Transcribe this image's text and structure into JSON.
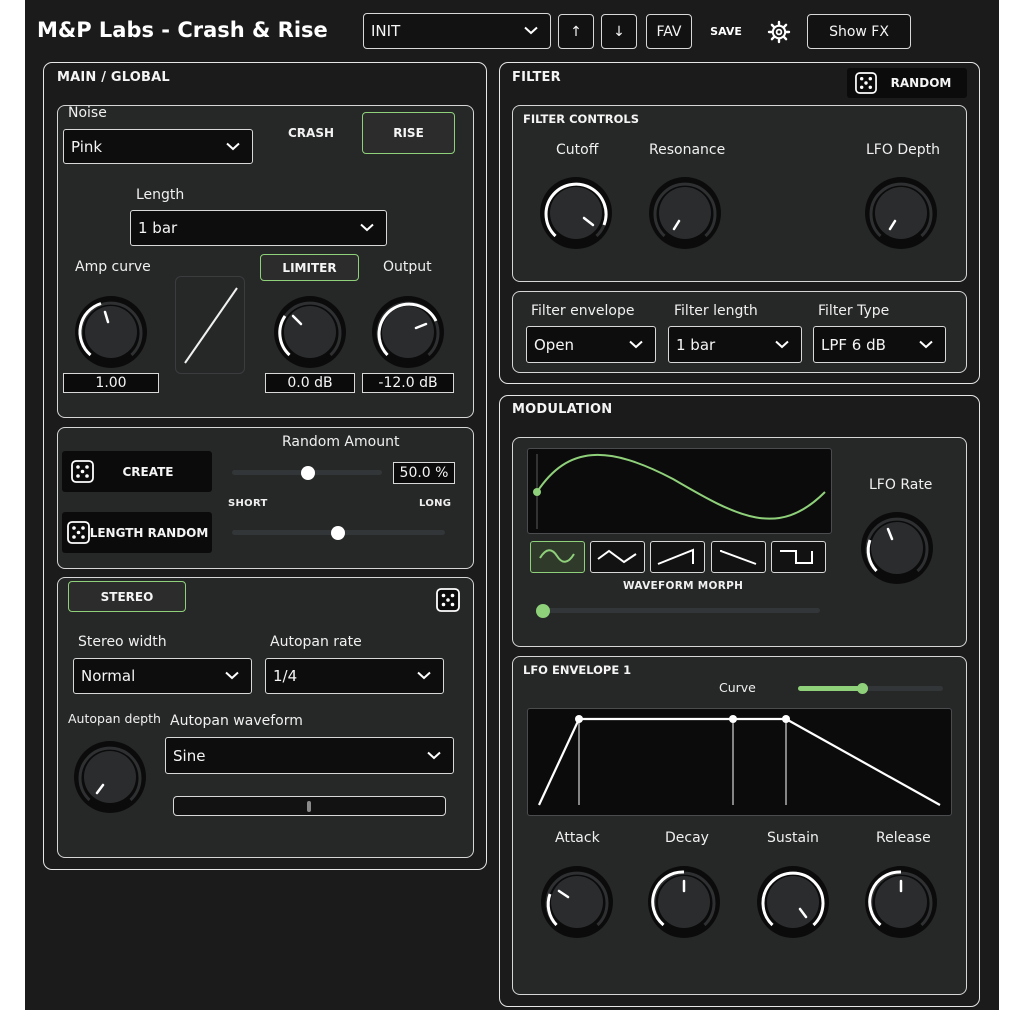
{
  "app": {
    "title": "M&P Labs - Crash & Rise"
  },
  "topbar": {
    "preset": "INIT",
    "up_label": "↑",
    "down_label": "↓",
    "fav_label": "FAV",
    "save_label": "SAVE",
    "showfx_label": "Show FX"
  },
  "main": {
    "title": "MAIN / GLOBAL",
    "noise_label": "Noise",
    "noise_value": "Pink",
    "crash_label": "CRASH",
    "rise_label": "RISE",
    "length_label": "Length",
    "length_value": "1 bar",
    "amp_curve_label": "Amp curve",
    "amp_curve_value": "1.00",
    "limiter_label": "LIMITER",
    "limiter_value": "0.0 dB",
    "output_label": "Output",
    "output_value": "-12.0 dB"
  },
  "random": {
    "create_label": "CREATE",
    "length_random_label": "LENGTH RANDOM",
    "amount_label": "Random Amount",
    "amount_value": "50.0 %",
    "amount_fraction": 0.5,
    "short_label": "SHORT",
    "long_label": "LONG",
    "length_fraction": 0.5
  },
  "stereo": {
    "title": "STEREO",
    "width_label": "Stereo width",
    "width_value": "Normal",
    "autopan_rate_label": "Autopan rate",
    "autopan_rate_value": "1/4",
    "autopan_depth_label": "Autopan depth",
    "autopan_waveform_label": "Autopan waveform",
    "autopan_waveform_value": "Sine"
  },
  "filter": {
    "title": "FILTER",
    "random_label": "RANDOM",
    "controls_title": "FILTER CONTROLS",
    "cutoff_label": "Cutoff",
    "resonance_label": "Resonance",
    "lfo_depth_label": "LFO Depth",
    "envelope_label": "Filter envelope",
    "envelope_value": "Open",
    "length_label": "Filter length",
    "length_value": "1 bar",
    "type_label": "Filter Type",
    "type_value": "LPF 6 dB"
  },
  "modulation": {
    "title": "MODULATION",
    "lfo_rate_label": "LFO Rate",
    "waveform_morph_label": "WAVEFORM MORPH",
    "waveform_morph_fraction": 0.0
  },
  "envelope": {
    "title": "LFO ENVELOPE 1",
    "curve_label": "Curve",
    "curve_fraction": 0.45,
    "attack_label": "Attack",
    "decay_label": "Decay",
    "sustain_label": "Sustain",
    "release_label": "Release"
  },
  "colors": {
    "accent_green": "#8fd07a",
    "background": "#1b1b1b",
    "panel": "#262727"
  }
}
